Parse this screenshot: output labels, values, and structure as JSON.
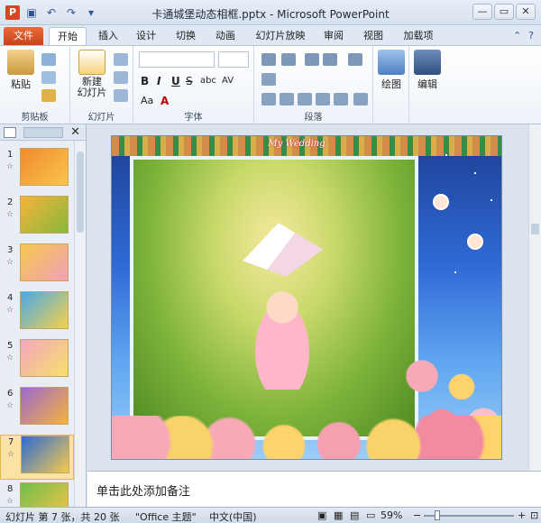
{
  "window": {
    "title": "卡通城堡动态相框.pptx - Microsoft PowerPoint",
    "app_icon": "P",
    "controls": [
      "—",
      "▭",
      "✕"
    ]
  },
  "qat": {
    "save_icon": "save-icon",
    "undo_icon": "undo-icon",
    "redo_icon": "redo-icon",
    "customize_icon": "qat-dropdown-icon"
  },
  "tabs": [
    "文件",
    "开始",
    "插入",
    "设计",
    "切换",
    "动画",
    "幻灯片放映",
    "审阅",
    "视图",
    "加载项"
  ],
  "active_tab": "开始",
  "ribbon": {
    "groups": [
      {
        "label": "剪贴板",
        "big_button": "粘贴"
      },
      {
        "label": "幻灯片",
        "big_button": "新建\n幻灯片"
      },
      {
        "label": "字体"
      },
      {
        "label": "段落"
      },
      {
        "label": "",
        "big_button": "绘图"
      },
      {
        "label": "",
        "big_button": "编辑"
      }
    ],
    "font_buttons": [
      "B",
      "I",
      "U",
      "S",
      "abc",
      "AV",
      "Aa",
      "A"
    ]
  },
  "slides": [
    {
      "number": "1",
      "colors": [
        "#f18a2c",
        "#f9c54d"
      ]
    },
    {
      "number": "2",
      "colors": [
        "#f6b43a",
        "#88b83c"
      ]
    },
    {
      "number": "3",
      "colors": [
        "#f7c84e",
        "#f0a0b6"
      ]
    },
    {
      "number": "4",
      "colors": [
        "#4aa8e8",
        "#f5d24a"
      ]
    },
    {
      "number": "5",
      "colors": [
        "#f4a6c0",
        "#f7e06a"
      ]
    },
    {
      "number": "6",
      "colors": [
        "#9a6ad1",
        "#f7b23a"
      ]
    },
    {
      "number": "7",
      "colors": [
        "#2b6cd3",
        "#f7c94e"
      ],
      "selected": true
    },
    {
      "number": "8",
      "colors": [
        "#6fbf4a",
        "#f7c24a"
      ]
    }
  ],
  "slide": {
    "header_text": "My Wedding"
  },
  "notes": {
    "placeholder": "单击此处添加备注"
  },
  "status": {
    "slide_info": "幻灯片 第 7 张，共 20 张",
    "theme": "\"Office 主题\"",
    "language": "中文(中国)",
    "zoom": "59%"
  },
  "colors": {
    "file_tab": "#d24726",
    "accent": "#2f5597",
    "selected_thumb": "#fbe3a6"
  }
}
